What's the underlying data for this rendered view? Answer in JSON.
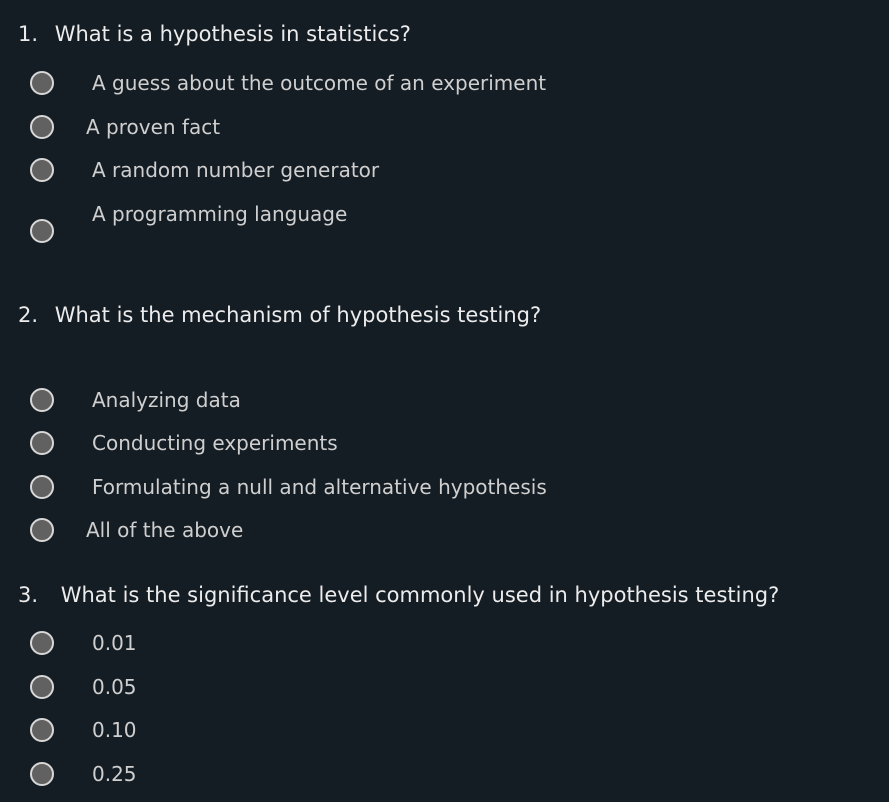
{
  "questions": [
    {
      "number": "1.",
      "text": "What is a hypothesis in statistics?",
      "options": [
        "A guess about the outcome of an experiment",
        "A proven fact",
        "A random number generator",
        "A programming language"
      ]
    },
    {
      "number": "2.",
      "text": "What is the mechanism of hypothesis testing?",
      "options": [
        "Analyzing data",
        "Conducting experiments",
        "Formulating a null and alternative hypothesis",
        "All of the above"
      ]
    },
    {
      "number": "3.",
      "text": "What is the significance level commonly used in hypothesis testing?",
      "options": [
        "0.01",
        "0.05",
        "0.10",
        "0.25"
      ]
    }
  ],
  "colors": {
    "background": "#151d24",
    "question_text": "#ececec",
    "option_text": "#cfcfcf",
    "radio_fill": "#616161",
    "radio_border": "#d8d8d8"
  }
}
